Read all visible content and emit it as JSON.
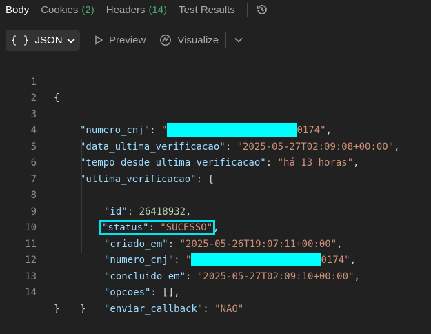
{
  "tabs": [
    {
      "label": "Body",
      "count": ""
    },
    {
      "label": "Cookies",
      "count": "(2)"
    },
    {
      "label": "Headers",
      "count": "(14)"
    },
    {
      "label": "Test Results",
      "count": ""
    }
  ],
  "toolbar": {
    "format_label": "JSON",
    "preview_label": "Preview",
    "visualize_label": "Visualize"
  },
  "colors": {
    "accent_count": "#4aa96c",
    "redaction": "#00ffff",
    "highlight_box": "#00e5f0"
  },
  "code_lines": [
    {
      "n": "1",
      "t": "{"
    },
    {
      "n": "2",
      "k": "\"numero_cnj\"",
      "v_suffix": "0174\"",
      "redacted": true
    },
    {
      "n": "3",
      "k": "\"data_ultima_verificacao\"",
      "v": "\"2025-05-27T02:09:08+00:00\""
    },
    {
      "n": "4",
      "k": "\"tempo_desde_ultima_verificacao\"",
      "v": "\"há 13 horas\""
    },
    {
      "n": "5",
      "k": "\"ultima_verificacao\"",
      "t2": "{"
    },
    {
      "n": "6",
      "k": "\"id\"",
      "num": "26418932"
    },
    {
      "n": "7",
      "k": "\"status\"",
      "v": "\"SUCESSO\""
    },
    {
      "n": "8",
      "k": "\"criado_em\"",
      "v": "\"2025-05-26T19:07:11+00:00\""
    },
    {
      "n": "9",
      "k": "\"numero_cnj\"",
      "v_suffix": "0174\"",
      "redacted": true
    },
    {
      "n": "10",
      "k": "\"concluido_em\"",
      "v": "\"2025-05-27T02:09:10+00:00\""
    },
    {
      "n": "11",
      "k": "\"opcoes\"",
      "t2": "[]"
    },
    {
      "n": "12",
      "k": "\"enviar_callback\"",
      "v": "\"NAO\""
    },
    {
      "n": "13",
      "t": "}"
    },
    {
      "n": "14",
      "t": "}"
    }
  ]
}
